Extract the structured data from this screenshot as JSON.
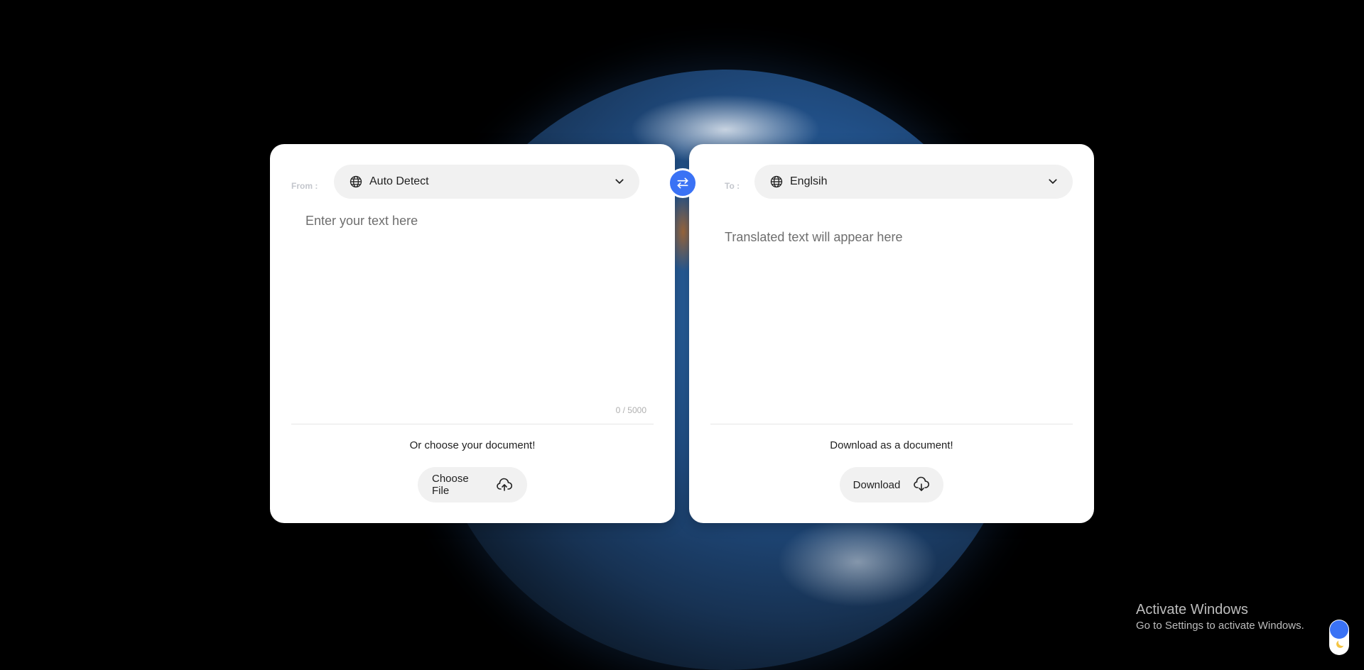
{
  "source": {
    "label": "From :",
    "language": "Auto Detect",
    "placeholder": "Enter your text here",
    "counter": "0 / 5000",
    "document_hint": "Or choose your document!",
    "choose_file_label": "Choose File"
  },
  "target": {
    "label": "To :",
    "language": "Englsih",
    "placeholder": "Translated text will appear here",
    "document_hint": "Download as a document!",
    "download_label": "Download"
  },
  "icons": {
    "globe": "globe-icon",
    "chevron": "chevron-down-icon",
    "swap": "swap-icon",
    "upload": "cloud-upload-icon",
    "download": "cloud-download-icon",
    "moon": "moon-icon"
  },
  "windows_watermark": {
    "title": "Activate Windows",
    "subtitle": "Go to Settings to activate Windows."
  },
  "colors": {
    "accent": "#3a72f5",
    "panel": "#ffffff",
    "pill": "#f1f1f1"
  }
}
